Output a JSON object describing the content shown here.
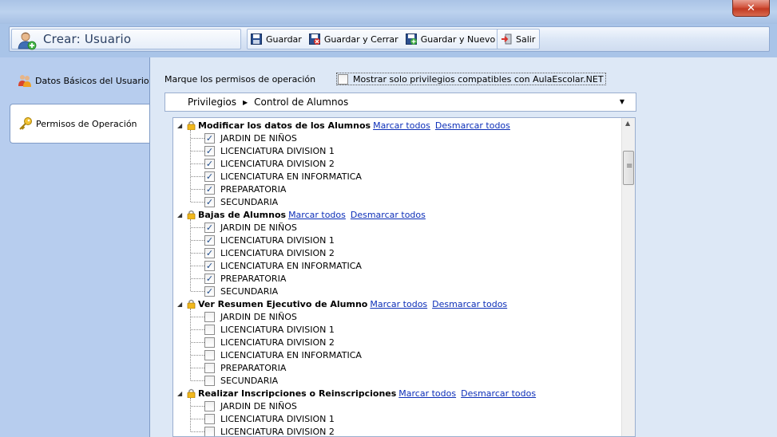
{
  "window": {
    "close_label": "✕"
  },
  "toolbar": {
    "title": "Crear: Usuario",
    "buttons": [
      {
        "label": "Guardar",
        "icon": "floppy-icon"
      },
      {
        "label": "Guardar y Cerrar",
        "icon": "floppy-close-icon"
      },
      {
        "label": "Guardar y Nuevo",
        "icon": "floppy-new-icon"
      },
      {
        "label": "Salir",
        "icon": "exit-icon"
      }
    ]
  },
  "sidebar": {
    "items": [
      {
        "label": "Datos Básicos del Usuario",
        "icon": "users-icon",
        "active": false
      },
      {
        "label": "Permisos de Operación",
        "icon": "key-icon",
        "active": true
      }
    ]
  },
  "main": {
    "instruction": "Marque los permisos de operación",
    "compat_label": "Mostrar solo privilegios compatibles con AulaEscolar.NET",
    "compat_checked": false,
    "breadcrumb": [
      "Privilegios",
      "Control de Alumnos"
    ],
    "mark_all": "Marcar todos",
    "unmark_all": "Desmarcar todos",
    "groups": [
      {
        "title": "Modificar los datos de los Alumnos",
        "items": [
          {
            "label": "JARDIN DE NIÑOS",
            "checked": true
          },
          {
            "label": "LICENCIATURA DIVISION 1",
            "checked": true
          },
          {
            "label": "LICENCIATURA DIVISION 2",
            "checked": true
          },
          {
            "label": "LICENCIATURA EN INFORMATICA",
            "checked": true
          },
          {
            "label": "PREPARATORIA",
            "checked": true
          },
          {
            "label": "SECUNDARIA",
            "checked": true
          }
        ]
      },
      {
        "title": "Bajas de Alumnos",
        "items": [
          {
            "label": "JARDIN DE NIÑOS",
            "checked": true
          },
          {
            "label": "LICENCIATURA DIVISION 1",
            "checked": true
          },
          {
            "label": "LICENCIATURA DIVISION 2",
            "checked": true
          },
          {
            "label": "LICENCIATURA EN INFORMATICA",
            "checked": true
          },
          {
            "label": "PREPARATORIA",
            "checked": true
          },
          {
            "label": "SECUNDARIA",
            "checked": true
          }
        ]
      },
      {
        "title": "Ver Resumen Ejecutivo de Alumno",
        "items": [
          {
            "label": "JARDIN DE NIÑOS",
            "checked": false
          },
          {
            "label": "LICENCIATURA DIVISION 1",
            "checked": false
          },
          {
            "label": "LICENCIATURA DIVISION 2",
            "checked": false
          },
          {
            "label": "LICENCIATURA EN INFORMATICA",
            "checked": false
          },
          {
            "label": "PREPARATORIA",
            "checked": false
          },
          {
            "label": "SECUNDARIA",
            "checked": false
          }
        ]
      },
      {
        "title": "Realizar Inscripciones o Reinscripciones",
        "items": [
          {
            "label": "JARDIN DE NIÑOS",
            "checked": false
          },
          {
            "label": "LICENCIATURA DIVISION 1",
            "checked": false
          },
          {
            "label": "LICENCIATURA DIVISION 2",
            "checked": false
          }
        ]
      }
    ]
  }
}
